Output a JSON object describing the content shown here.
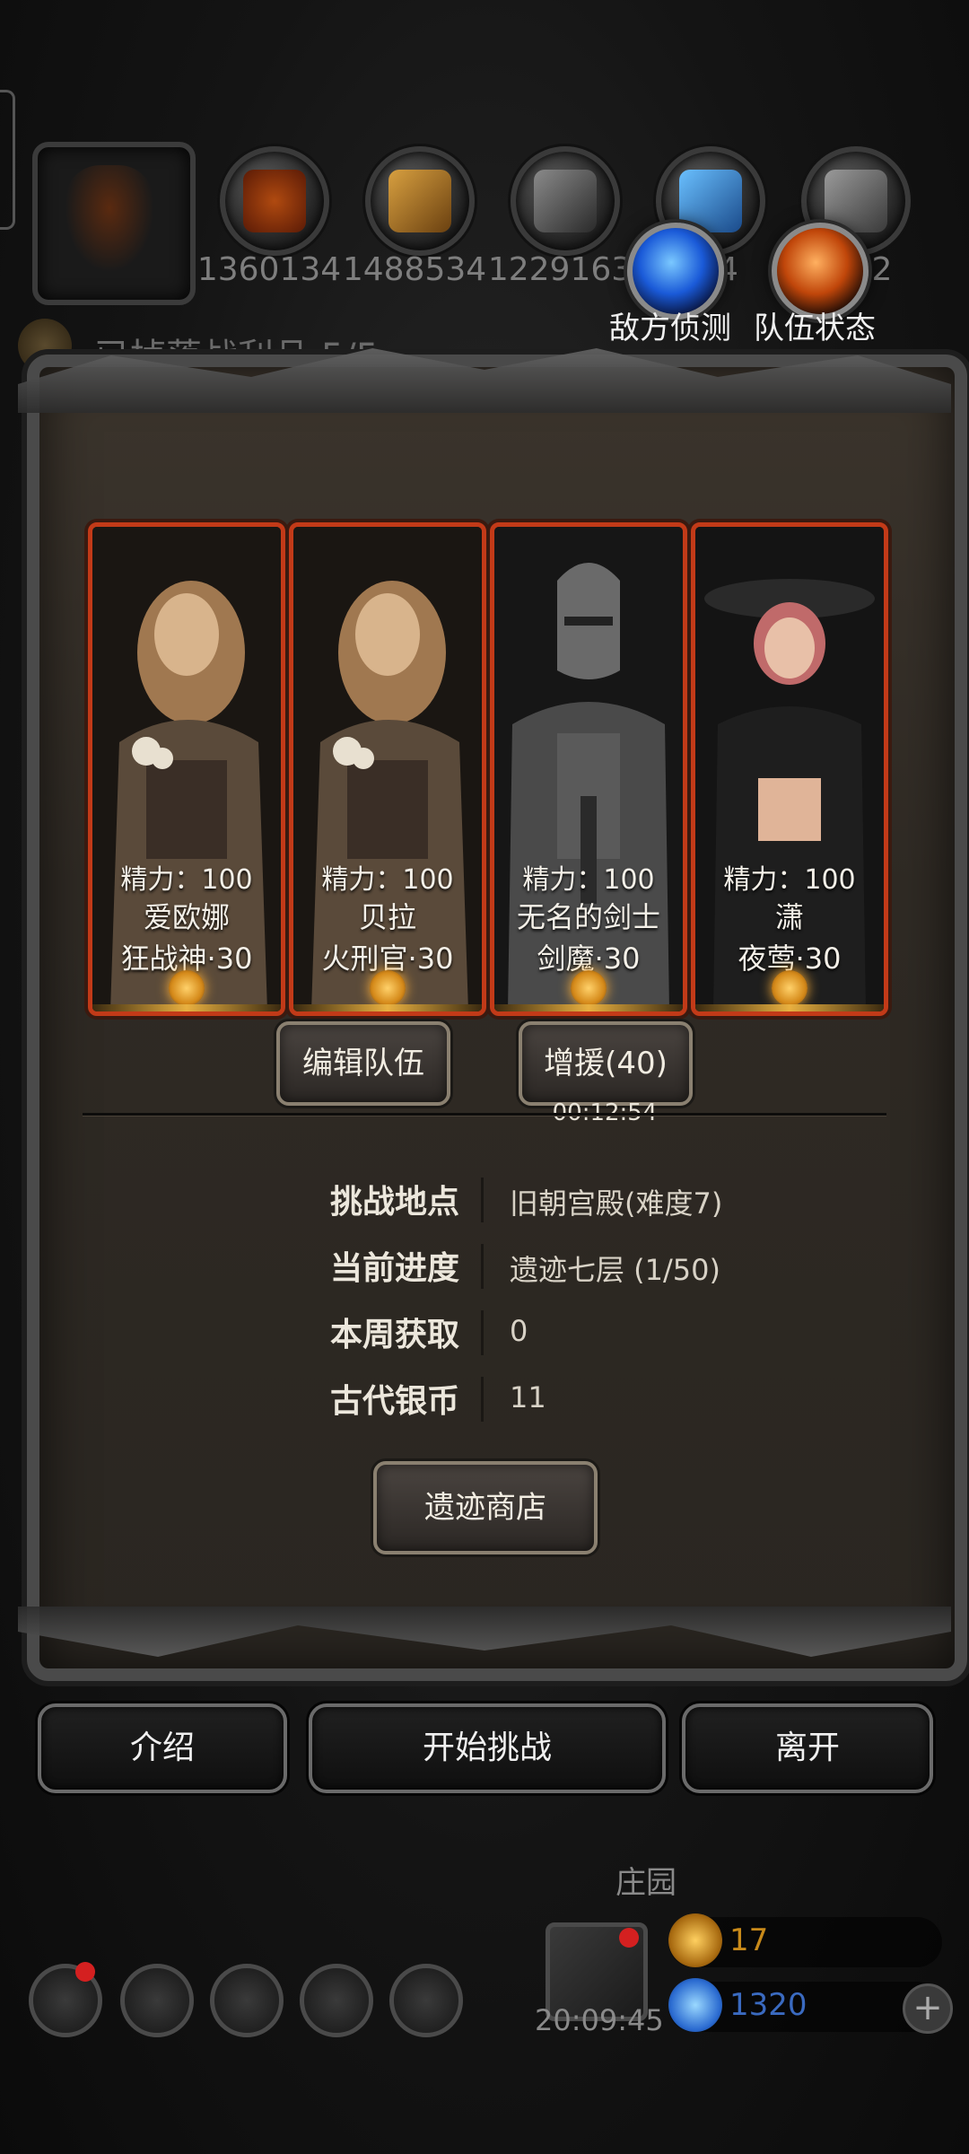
{
  "top_bar": {
    "resources": [
      {
        "icon": "meat-icon",
        "value": "1360134"
      },
      {
        "icon": "wood-icon",
        "value": "1488534"
      },
      {
        "icon": "iron-icon",
        "value": "1229163"
      },
      {
        "icon": "crystal-icon",
        "value": "54"
      },
      {
        "icon": "ore-icon",
        "value": "482"
      }
    ],
    "enemy_scout_label": "敌方侦测",
    "team_status_label": "队伍状态",
    "background_text": "已掉落战利品 5/5"
  },
  "team": {
    "members": [
      {
        "energy": "精力：100",
        "name": "爱欧娜",
        "class": "狂战神·30"
      },
      {
        "energy": "精力：100",
        "name": "贝拉",
        "class": "火刑官·30"
      },
      {
        "energy": "精力：100",
        "name": "无名的剑士",
        "class": "剑魔·30"
      },
      {
        "energy": "精力：100",
        "name": "潇",
        "class": "夜莺·30"
      }
    ],
    "edit_button": "编辑队伍",
    "reinforce_button": "增援(40)",
    "reinforce_timer": "00:12:54"
  },
  "info": {
    "rows": [
      {
        "label": "挑战地点",
        "value": "旧朝宫殿(难度7)"
      },
      {
        "label": "当前进度",
        "value": "遗迹七层 (1/50)"
      },
      {
        "label": "本周获取",
        "value": "0"
      },
      {
        "label": "古代银币",
        "value": "11"
      }
    ],
    "shop_button": "遗迹商店"
  },
  "footer": {
    "intro_button": "介绍",
    "start_button": "开始挑战",
    "leave_button": "离开"
  },
  "bottom": {
    "location": "庄园",
    "time": "20:09:45",
    "gold": "17",
    "gems": "1320"
  },
  "colors": {
    "card_border": "#c23a18",
    "gold_text": "#e0a020",
    "gem_text": "#3a7ad8"
  }
}
